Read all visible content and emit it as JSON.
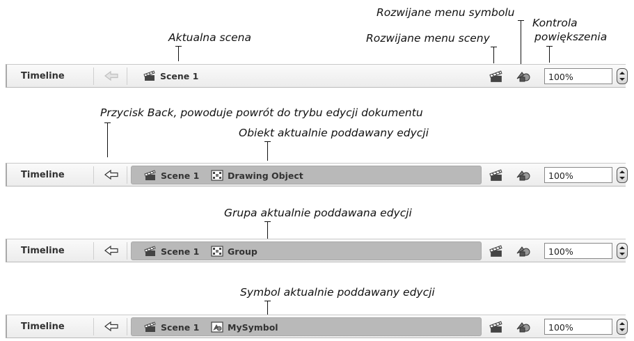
{
  "annotations": {
    "current_scene": "Aktualna scena",
    "symbol_menu": "Rozwijane menu symbolu",
    "scene_menu": "Rozwijane menu sceny",
    "zoom_control_line1": "Kontrola",
    "zoom_control_line2": "powiększenia",
    "back_button": "Przycisk Back, powoduje powrót do trybu edycji dokumentu",
    "edited_object": "Obiekt aktualnie poddawany edycji",
    "edited_group": "Grupa aktualnie poddawana edycji",
    "edited_symbol": "Symbol aktualnie poddawany edycji"
  },
  "bars": [
    {
      "timeline_label": "Timeline",
      "back_enabled": false,
      "scene": "Scene 1",
      "item": null,
      "item_icon": null,
      "zoom": "100%"
    },
    {
      "timeline_label": "Timeline",
      "back_enabled": true,
      "scene": "Scene 1",
      "item": "Drawing Object",
      "item_icon": "drawing-object-icon",
      "zoom": "100%"
    },
    {
      "timeline_label": "Timeline",
      "back_enabled": true,
      "scene": "Scene 1",
      "item": "Group",
      "item_icon": "group-icon",
      "zoom": "100%"
    },
    {
      "timeline_label": "Timeline",
      "back_enabled": true,
      "scene": "Scene 1",
      "item": "MySymbol",
      "item_icon": "symbol-icon",
      "zoom": "100%"
    }
  ],
  "icons": {
    "scene": "clapperboard-icon",
    "edit_scene": "clapperboard-icon",
    "edit_symbol": "shapes-icon",
    "back": "arrow-left-icon",
    "stepper": "chevron-up-down-icon"
  },
  "colors": {
    "breadcrumb_active": "#b9b9b9",
    "back_disabled": "#c0c0c0",
    "back_enabled": "#333333"
  }
}
